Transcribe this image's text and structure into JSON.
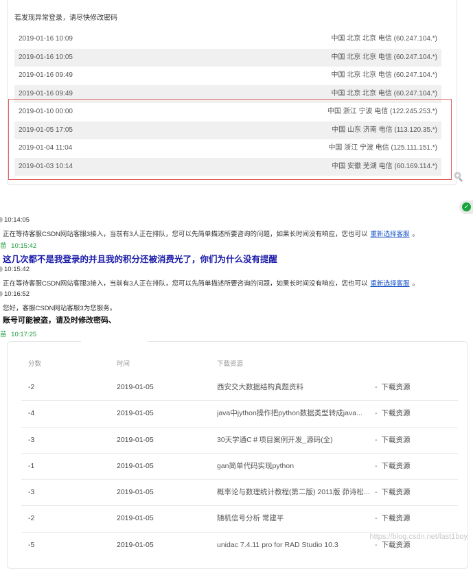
{
  "login_panel": {
    "warning": "若发现异常登录，请尽快修改密码",
    "rows": [
      {
        "time": "2019-01-16 10:09",
        "location": "中国 北京 北京 电信 (60.247.104.*)"
      },
      {
        "time": "2019-01-16 10:05",
        "location": "中国 北京 北京 电信 (60.247.104.*)"
      },
      {
        "time": "2019-01-16 09:49",
        "location": "中国 北京 北京 电信 (60.247.104.*)"
      },
      {
        "time": "2019-01-16 09:49",
        "location": "中国 北京 北京 电信 (60.247.104.*)"
      },
      {
        "time": "2019-01-10 00:00",
        "location": "中国 浙江 宁波 电信 (122.245.253.*)"
      },
      {
        "time": "2019-01-05 17:05",
        "location": "中国 山东 济南 电信 (113.120.35.*)"
      },
      {
        "time": "2019-01-04 11:04",
        "location": "中国 浙江 宁波 电信 (125.111.151.*)"
      },
      {
        "time": "2019-01-03 10:14",
        "location": "中国 安徽 芜湖 电信 (60.169.114.*)"
      }
    ]
  },
  "chat": {
    "t1": "10:14:05",
    "sys1_text": "正在等待客服CSDN网站客服3接入，当前有3人正在排队，您可以先简单描述所要咨询的问题，如果长时间没有响应，您也可以",
    "sys1_link": "重新选择客服",
    "sys1_tail": "。",
    "user1_name": "苗",
    "user1_time": "10:15:42",
    "user1_msg": "这几次都不是我登录的并且我的积分还被消费光了，你们为什么没有提醒",
    "t2": "10:15:42",
    "sys2_text": "正在等待客服CSDN网站客服3接入，当前有3人正在排队，您可以先简单描述所要咨询的问题，如果长时间没有响应，您也可以",
    "sys2_link": "重新选择客服",
    "sys2_tail": "。",
    "t3": "10:16:52",
    "agent_greet": "您好，客服CSDN网站客服3为您服务。",
    "agent_msg": "账号可能被盗，请及时修改密码、",
    "user2_name": "苗",
    "user2_time": "10:17:25"
  },
  "downloads": {
    "headers": {
      "score": "分数",
      "time": "时间",
      "resource": "下载资源"
    },
    "rows": [
      {
        "score": "-2",
        "time": "2019-01-05",
        "resource": "西安交大数据结构真题资料",
        "action": "下载资源"
      },
      {
        "score": "-4",
        "time": "2019-01-05",
        "resource": "java中jython操作把python数据类型转成java...",
        "action": "下载资源"
      },
      {
        "score": "-3",
        "time": "2019-01-05",
        "resource": "30天学通C＃项目案例开发_源码(全)",
        "action": "下载资源"
      },
      {
        "score": "-1",
        "time": "2019-01-05",
        "resource": "gan简单代码实现python",
        "action": "下载资源"
      },
      {
        "score": "-3",
        "time": "2019-01-05",
        "resource": "概率论与数理统计教程(第二版) 2011版 茆诗松...",
        "action": "下载资源"
      },
      {
        "score": "-2",
        "time": "2019-01-05",
        "resource": "随机信号分析 常建平",
        "action": "下载资源"
      },
      {
        "score": "-5",
        "time": "2019-01-05",
        "resource": "unidac 7.4.11 pro for RAD Studio 10.3",
        "action": "下载资源"
      }
    ]
  },
  "watermark": "https://blog.csdn.net/last1boy",
  "colors": {
    "highlight_border": "#e05b5b",
    "link": "#1a55c9",
    "user_name": "#1a9b3a",
    "user_msg": "#1a1aa8"
  }
}
